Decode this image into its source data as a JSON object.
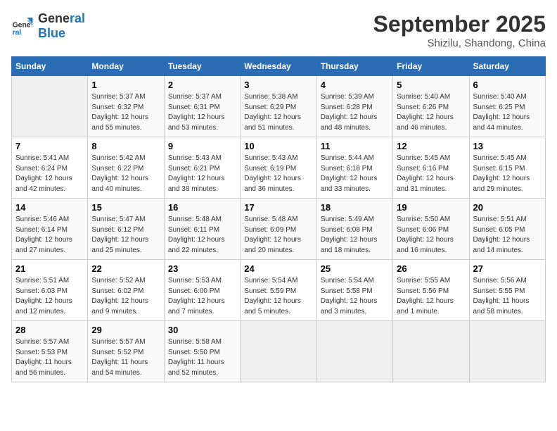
{
  "header": {
    "logo_line1": "General",
    "logo_line2": "Blue",
    "month": "September 2025",
    "location": "Shizilu, Shandong, China"
  },
  "weekdays": [
    "Sunday",
    "Monday",
    "Tuesday",
    "Wednesday",
    "Thursday",
    "Friday",
    "Saturday"
  ],
  "weeks": [
    [
      {
        "day": "",
        "info": ""
      },
      {
        "day": "1",
        "info": "Sunrise: 5:37 AM\nSunset: 6:32 PM\nDaylight: 12 hours\nand 55 minutes."
      },
      {
        "day": "2",
        "info": "Sunrise: 5:37 AM\nSunset: 6:31 PM\nDaylight: 12 hours\nand 53 minutes."
      },
      {
        "day": "3",
        "info": "Sunrise: 5:38 AM\nSunset: 6:29 PM\nDaylight: 12 hours\nand 51 minutes."
      },
      {
        "day": "4",
        "info": "Sunrise: 5:39 AM\nSunset: 6:28 PM\nDaylight: 12 hours\nand 48 minutes."
      },
      {
        "day": "5",
        "info": "Sunrise: 5:40 AM\nSunset: 6:26 PM\nDaylight: 12 hours\nand 46 minutes."
      },
      {
        "day": "6",
        "info": "Sunrise: 5:40 AM\nSunset: 6:25 PM\nDaylight: 12 hours\nand 44 minutes."
      }
    ],
    [
      {
        "day": "7",
        "info": "Sunrise: 5:41 AM\nSunset: 6:24 PM\nDaylight: 12 hours\nand 42 minutes."
      },
      {
        "day": "8",
        "info": "Sunrise: 5:42 AM\nSunset: 6:22 PM\nDaylight: 12 hours\nand 40 minutes."
      },
      {
        "day": "9",
        "info": "Sunrise: 5:43 AM\nSunset: 6:21 PM\nDaylight: 12 hours\nand 38 minutes."
      },
      {
        "day": "10",
        "info": "Sunrise: 5:43 AM\nSunset: 6:19 PM\nDaylight: 12 hours\nand 36 minutes."
      },
      {
        "day": "11",
        "info": "Sunrise: 5:44 AM\nSunset: 6:18 PM\nDaylight: 12 hours\nand 33 minutes."
      },
      {
        "day": "12",
        "info": "Sunrise: 5:45 AM\nSunset: 6:16 PM\nDaylight: 12 hours\nand 31 minutes."
      },
      {
        "day": "13",
        "info": "Sunrise: 5:45 AM\nSunset: 6:15 PM\nDaylight: 12 hours\nand 29 minutes."
      }
    ],
    [
      {
        "day": "14",
        "info": "Sunrise: 5:46 AM\nSunset: 6:14 PM\nDaylight: 12 hours\nand 27 minutes."
      },
      {
        "day": "15",
        "info": "Sunrise: 5:47 AM\nSunset: 6:12 PM\nDaylight: 12 hours\nand 25 minutes."
      },
      {
        "day": "16",
        "info": "Sunrise: 5:48 AM\nSunset: 6:11 PM\nDaylight: 12 hours\nand 22 minutes."
      },
      {
        "day": "17",
        "info": "Sunrise: 5:48 AM\nSunset: 6:09 PM\nDaylight: 12 hours\nand 20 minutes."
      },
      {
        "day": "18",
        "info": "Sunrise: 5:49 AM\nSunset: 6:08 PM\nDaylight: 12 hours\nand 18 minutes."
      },
      {
        "day": "19",
        "info": "Sunrise: 5:50 AM\nSunset: 6:06 PM\nDaylight: 12 hours\nand 16 minutes."
      },
      {
        "day": "20",
        "info": "Sunrise: 5:51 AM\nSunset: 6:05 PM\nDaylight: 12 hours\nand 14 minutes."
      }
    ],
    [
      {
        "day": "21",
        "info": "Sunrise: 5:51 AM\nSunset: 6:03 PM\nDaylight: 12 hours\nand 12 minutes."
      },
      {
        "day": "22",
        "info": "Sunrise: 5:52 AM\nSunset: 6:02 PM\nDaylight: 12 hours\nand 9 minutes."
      },
      {
        "day": "23",
        "info": "Sunrise: 5:53 AM\nSunset: 6:00 PM\nDaylight: 12 hours\nand 7 minutes."
      },
      {
        "day": "24",
        "info": "Sunrise: 5:54 AM\nSunset: 5:59 PM\nDaylight: 12 hours\nand 5 minutes."
      },
      {
        "day": "25",
        "info": "Sunrise: 5:54 AM\nSunset: 5:58 PM\nDaylight: 12 hours\nand 3 minutes."
      },
      {
        "day": "26",
        "info": "Sunrise: 5:55 AM\nSunset: 5:56 PM\nDaylight: 12 hours\nand 1 minute."
      },
      {
        "day": "27",
        "info": "Sunrise: 5:56 AM\nSunset: 5:55 PM\nDaylight: 11 hours\nand 58 minutes."
      }
    ],
    [
      {
        "day": "28",
        "info": "Sunrise: 5:57 AM\nSunset: 5:53 PM\nDaylight: 11 hours\nand 56 minutes."
      },
      {
        "day": "29",
        "info": "Sunrise: 5:57 AM\nSunset: 5:52 PM\nDaylight: 11 hours\nand 54 minutes."
      },
      {
        "day": "30",
        "info": "Sunrise: 5:58 AM\nSunset: 5:50 PM\nDaylight: 11 hours\nand 52 minutes."
      },
      {
        "day": "",
        "info": ""
      },
      {
        "day": "",
        "info": ""
      },
      {
        "day": "",
        "info": ""
      },
      {
        "day": "",
        "info": ""
      }
    ]
  ]
}
